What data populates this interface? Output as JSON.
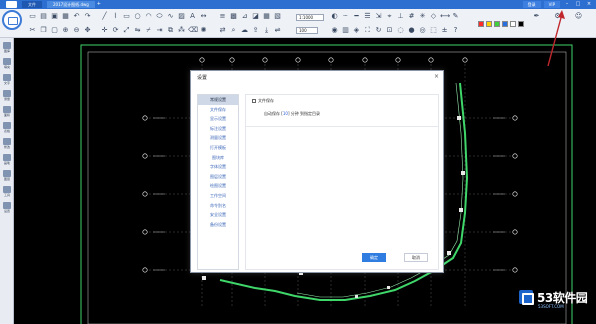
{
  "titlebar": {
    "tabs": [
      "文件",
      "2017设计图纸.dwg"
    ],
    "new_tab_icon": "plus-icon",
    "buttons": [
      "登录",
      "VIP"
    ],
    "window_controls": [
      "minimize-icon",
      "maximize-icon",
      "close-icon"
    ]
  },
  "ribbon": {
    "scale_value": "1:1000",
    "line_width_value": "100",
    "colors": [
      "#ff2a2a",
      "#ffd400",
      "#3fcf3f",
      "#2a6fe0",
      "#ffffff",
      "#000000"
    ]
  },
  "sidebar": {
    "items": [
      "图库",
      "填充",
      "文字",
      "测量",
      "面积",
      "表格",
      "修改",
      "画笔",
      "图层",
      "工具",
      "设置"
    ]
  },
  "dialog": {
    "title": "设置",
    "nav": [
      "常规设置",
      "文件保存",
      "显示设置",
      "标注设置",
      "测量设置",
      "打开模板",
      "图块库",
      "字体设置",
      "图层设置",
      "绘图设置",
      "工作空间",
      "命令别名",
      "安全设置",
      "备份设置"
    ],
    "selected_index": 0,
    "content_head": "文件保存",
    "content_line_pre": "自动保存 [",
    "content_line_hl": "10",
    "content_line_post": "] 分钟 到指定目录",
    "ok_label": "确定",
    "cancel_label": "取消"
  },
  "watermark": {
    "text": "53软件园",
    "sub": "53SOFT.COM"
  }
}
